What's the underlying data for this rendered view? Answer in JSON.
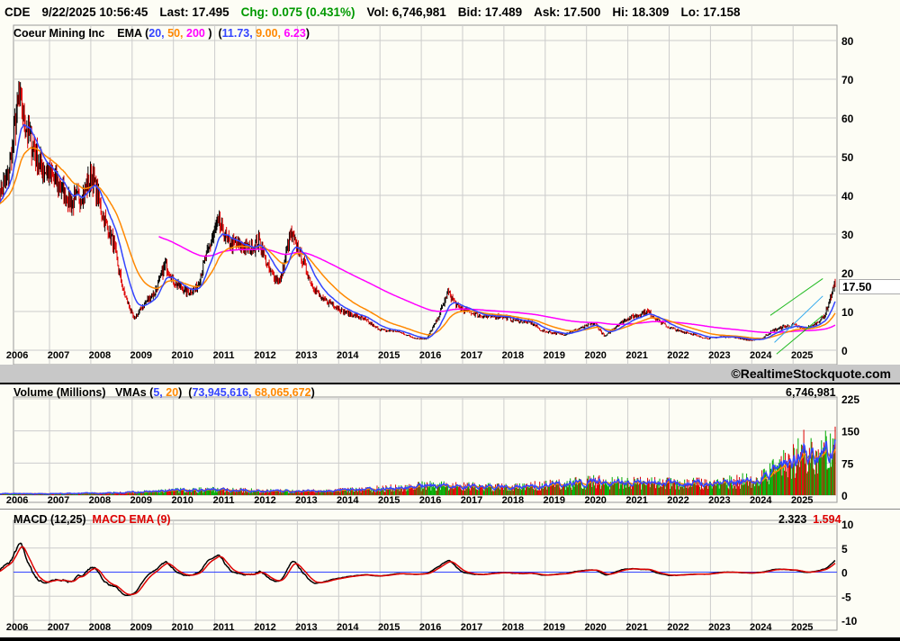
{
  "header": {
    "symbol": "CDE",
    "datetime": "9/22/2025 10:56:45",
    "last": "Last: 17.495",
    "chg": "Chg: 0.075 (0.431%)",
    "vol": "Vol: 6,746,981",
    "bid": "Bid: 17.489",
    "ask": "Ask: 17.500",
    "hi": "Hi: 18.309",
    "lo": "Lo: 17.158"
  },
  "price_panel": {
    "name": "Coeur Mining Inc",
    "ema_label": "EMA (",
    "ema_p1": "20,",
    "ema_p2": "50,",
    "ema_p3": "200",
    "ema_close": ")",
    "ema_v_open": "(",
    "ema_v1": "11.73,",
    "ema_v2": "9.00,",
    "ema_v3": "6.23",
    "ema_v_close": ")",
    "last_price": "17.50",
    "y_ticks": [
      "80",
      "70",
      "60",
      "50",
      "40",
      "30",
      "20",
      "10",
      "0"
    ]
  },
  "watermark": "©RealtimeStockquote.com",
  "volume_panel": {
    "label": "Volume (Millions)",
    "vma_label": "VMAs (",
    "vma_p1": "5,",
    "vma_p2": "20",
    "vma_close": ")",
    "vma_open": "(",
    "vma_v1": "73,945,616,",
    "vma_v2": "68,065,672",
    "vma_v_close": ")",
    "current": "6,746,981",
    "y_ticks": [
      "225",
      "150",
      "75",
      "0"
    ]
  },
  "macd_panel": {
    "label": "MACD (12,25)",
    "ema_label": "MACD EMA (9)",
    "v1": "2.323",
    "v2": "1.594",
    "y_ticks": [
      "10",
      "5",
      "0",
      "-5",
      "-10"
    ]
  },
  "colors": {
    "ema20": "#3344ff",
    "ema50": "#ff8800",
    "ema200": "#ff00ff",
    "up": "#000000",
    "down": "#dd0000",
    "chg": "#009900",
    "vol_up": "#00aa00",
    "vol_down": "#dd0000"
  },
  "chart_data": {
    "type": "line",
    "years": [
      "2006",
      "2007",
      "2008",
      "2009",
      "2010",
      "2011",
      "2012",
      "2013",
      "2014",
      "2015",
      "2016",
      "2017",
      "2018",
      "2019",
      "2020",
      "2021",
      "2022",
      "2023",
      "2024",
      "2025"
    ],
    "price_quarterly": {
      "start": 2005.75,
      "step": 0.25,
      "values": [
        40,
        45,
        65,
        55,
        48,
        45,
        42,
        38,
        40,
        45,
        35,
        28,
        15,
        8,
        12,
        15,
        22,
        17,
        15,
        16,
        25,
        33,
        28,
        27,
        26,
        28,
        20,
        18,
        30,
        24,
        17,
        13,
        12,
        10,
        9,
        8,
        6,
        5,
        5,
        4,
        3,
        3,
        8,
        15,
        11,
        10,
        9,
        8.5,
        9,
        8,
        7.5,
        7,
        5,
        4.5,
        4,
        5,
        6,
        7,
        3.5,
        6,
        8,
        9,
        10,
        8,
        6,
        5,
        4.5,
        3.5,
        3,
        3.5,
        3.5,
        3,
        2.5,
        3,
        5,
        6,
        6.5,
        5.5,
        6.5,
        9,
        17.5
      ]
    },
    "volume_yearly_millions": {
      "start": 2006,
      "values": [
        3,
        3,
        4,
        6,
        10,
        12,
        9,
        8,
        10,
        14,
        20,
        18,
        16,
        22,
        28,
        26,
        24,
        25,
        35,
        90
      ]
    },
    "ylim_price": [
      0,
      80
    ],
    "ylim_volume": [
      0,
      225
    ],
    "ylim_macd": [
      -10,
      10
    ]
  }
}
